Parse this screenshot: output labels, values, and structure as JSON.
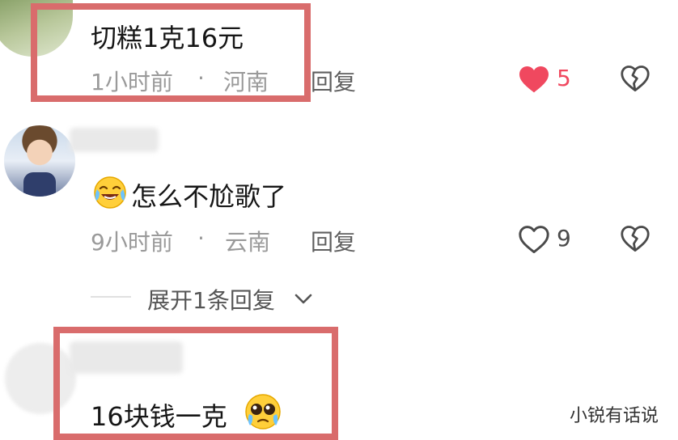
{
  "comments": [
    {
      "text": "切糕1克16元",
      "time": "1小时前",
      "sep": "·",
      "location": "河南",
      "reply_label": "回复",
      "likes": "5",
      "liked": true
    },
    {
      "text": "怎么不尬歌了",
      "time": "9小时前",
      "sep": "·",
      "location": "云南",
      "reply_label": "回复",
      "likes": "9",
      "liked": false,
      "expand_label": "展开1条回复"
    },
    {
      "text": "16块钱一克"
    }
  ],
  "watermark": "小锐有话说",
  "colors": {
    "highlight_box": "#d96c6c",
    "liked_heart": "#f0485f",
    "meta_text": "#9a9a9a"
  },
  "icons": {
    "like_active": "heart-filled-icon",
    "like": "heart-outline-icon",
    "dislike": "broken-heart-icon",
    "expand": "chevron-down-icon"
  }
}
